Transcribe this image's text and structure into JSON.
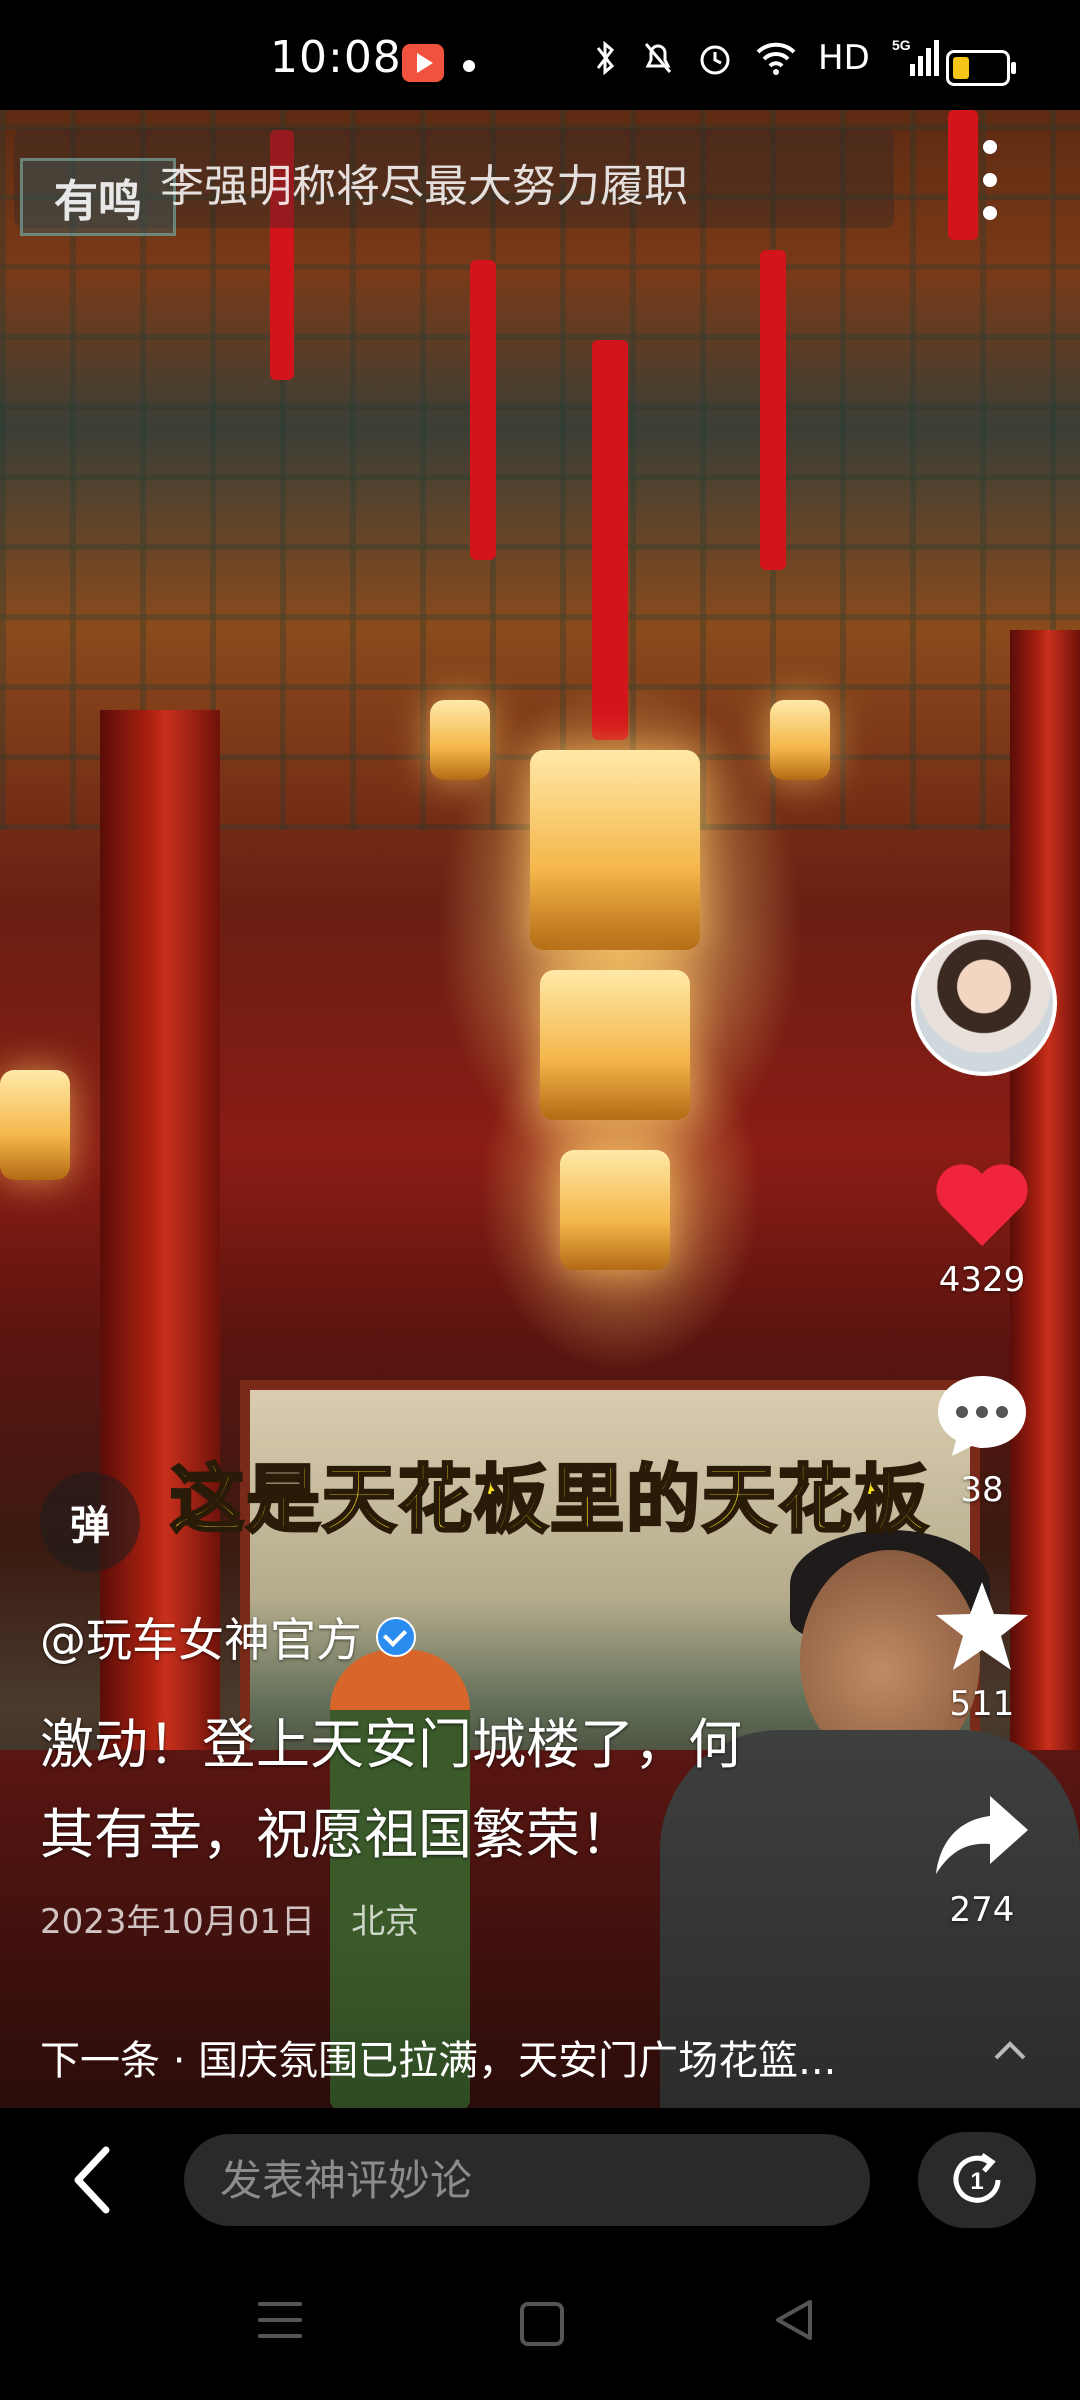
{
  "status_bar": {
    "time": "10:08",
    "network": "5G",
    "hd_label": "HD",
    "icons": [
      "app-notification-icon",
      "bluetooth-icon",
      "mute-icon",
      "alarm-icon",
      "wifi-icon",
      "signal-icon",
      "battery-icon"
    ]
  },
  "top_bar": {
    "logo_text": "有鸣",
    "title": "李强明称将尽最大努力履职"
  },
  "video": {
    "caption": "这是天花板里的天花板"
  },
  "actions": {
    "likes": "4329",
    "comments": "38",
    "favorites": "511",
    "shares": "274",
    "like_color": "#f0243a"
  },
  "danmaku": {
    "label": "弹"
  },
  "post": {
    "author": "@玩车女神官方",
    "description_line1": "激动！登上天安门城楼了，何",
    "description_line2": "其有幸，祝愿祖国繁荣！",
    "date": "2023年10月01日",
    "location": "北京"
  },
  "next": {
    "text": "下一条 · 国庆氛围已拉满，天安门广场花篮..."
  },
  "comment_bar": {
    "placeholder": "发表神评妙论"
  }
}
